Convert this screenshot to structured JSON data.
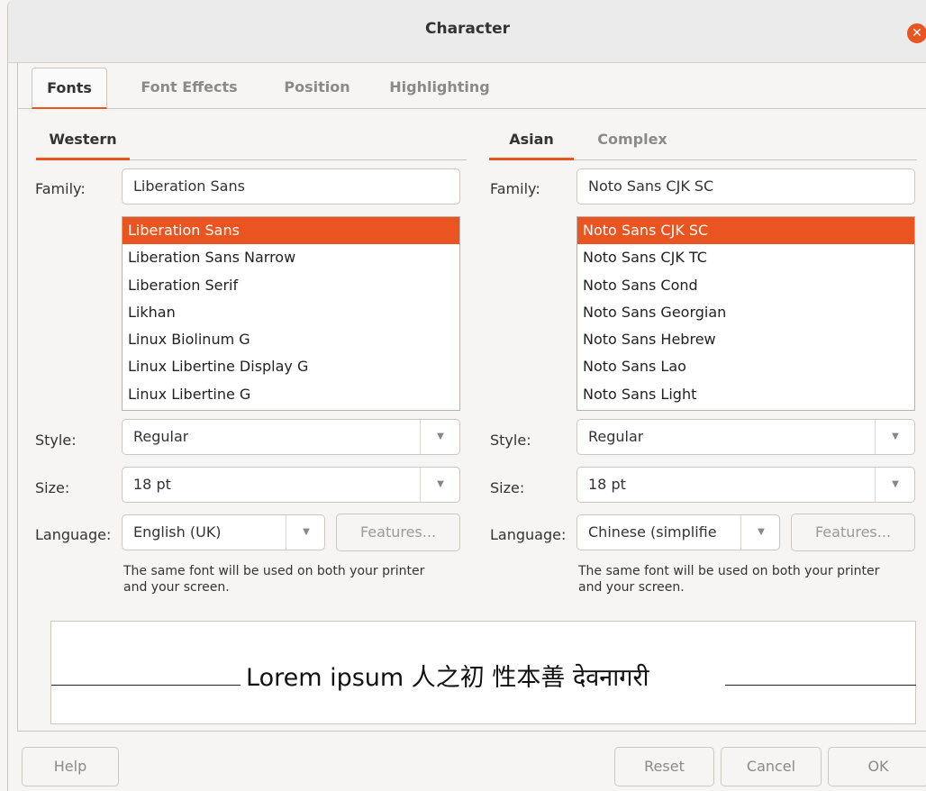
{
  "dialog": {
    "title": "Character"
  },
  "tabs": [
    "Fonts",
    "Font Effects",
    "Position",
    "Highlighting"
  ],
  "western": {
    "tab": "Western",
    "family_label": "Family:",
    "family_value": "Liberation Sans",
    "family_list": [
      "Liberation Sans",
      "Liberation Sans Narrow",
      "Liberation Serif",
      "Likhan",
      "Linux Biolinum G",
      "Linux Libertine Display G",
      "Linux Libertine G"
    ],
    "style_label": "Style:",
    "style_value": "Regular",
    "size_label": "Size:",
    "size_value": "18 pt",
    "language_label": "Language:",
    "language_value": "English (UK)",
    "features_button": "Features...",
    "note": "The same font will be used on both your printer and your screen."
  },
  "asian": {
    "tab": "Asian",
    "complex_tab": "Complex",
    "family_label": "Family:",
    "family_value": "Noto Sans CJK SC",
    "family_list": [
      "Noto Sans CJK SC",
      "Noto Sans CJK TC",
      "Noto Sans Cond",
      "Noto Sans Georgian",
      "Noto Sans Hebrew",
      "Noto Sans Lao",
      "Noto Sans Light"
    ],
    "style_label": "Style:",
    "style_value": "Regular",
    "size_label": "Size:",
    "size_value": "18 pt",
    "language_label": "Language:",
    "language_value": "Chinese (simplifie",
    "features_button": "Features...",
    "note": "The same font will be used on both your printer and your screen."
  },
  "preview": {
    "text": "Lorem ipsum   人之初 性本善  देवनागरी"
  },
  "footer": {
    "help": "Help",
    "reset": "Reset",
    "cancel": "Cancel",
    "ok": "OK"
  },
  "colors": {
    "accent": "#e95420",
    "close": "#e95420"
  }
}
